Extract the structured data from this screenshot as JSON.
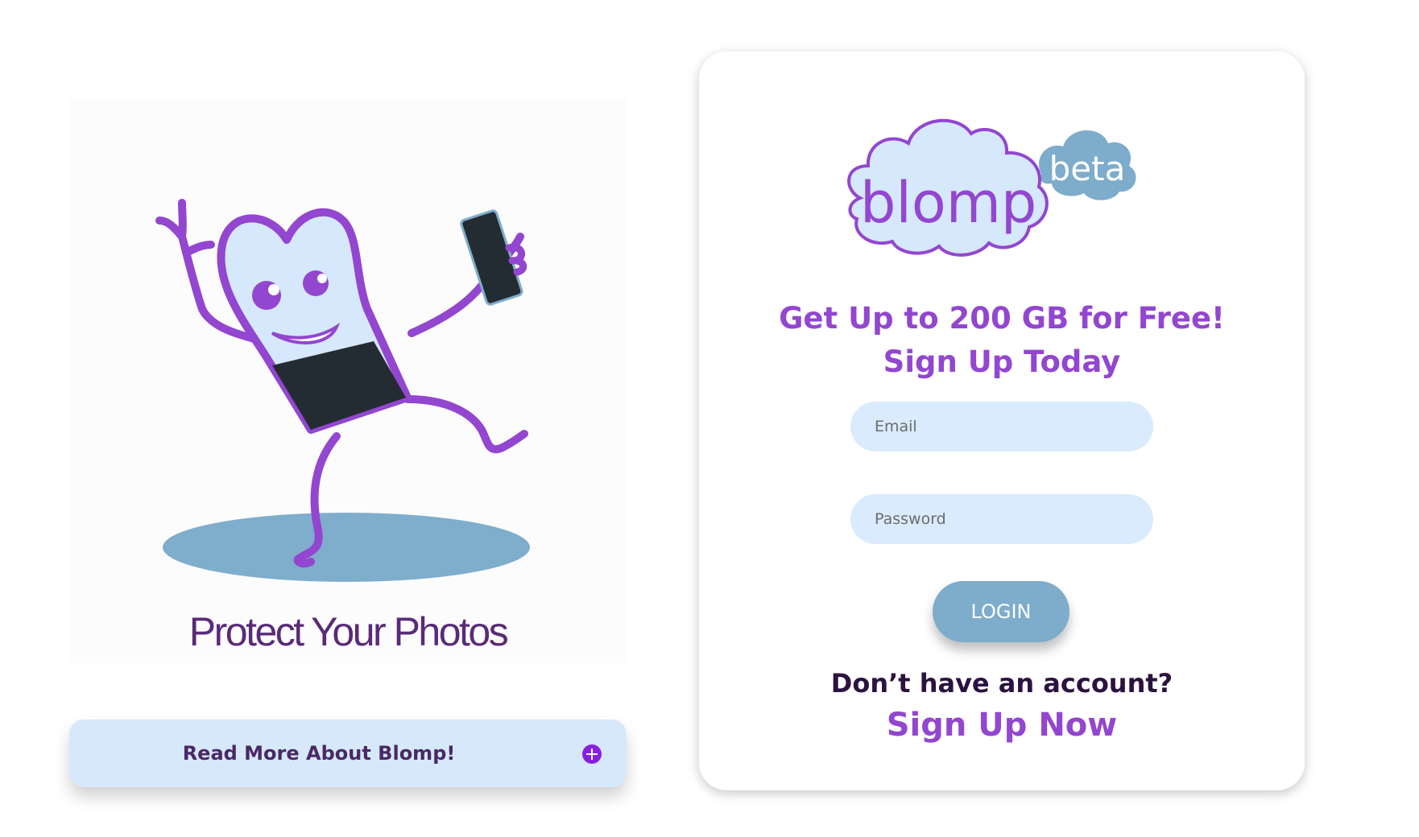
{
  "hero": {
    "caption": "Protect Your Photos",
    "illustration_icon": "dancing-heart-mascot-with-phone"
  },
  "read_more": {
    "label": "Read More About Blomp!",
    "icon": "plus-circle-icon"
  },
  "login_card": {
    "logo": {
      "wordmark": "blomp",
      "badge": "beta"
    },
    "headline_line1": "Get Up to 200 GB for Free!",
    "headline_line2": "Sign Up Today",
    "email": {
      "placeholder": "Email",
      "value": ""
    },
    "password": {
      "placeholder": "Password",
      "value": ""
    },
    "login_button": "LOGIN",
    "no_account_text": "Don’t have an account?",
    "signup_link": "Sign Up Now"
  },
  "colors": {
    "brand_purple": "#9346cf",
    "field_bg": "#d9ebfc",
    "button_blue": "#7eaccb",
    "dark_text": "#2b1240",
    "plus_icon": "#8a1ee0"
  }
}
